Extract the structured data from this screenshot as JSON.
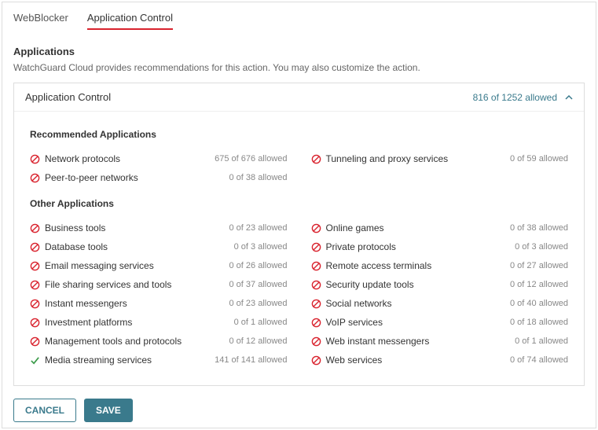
{
  "tabs": {
    "webblocker": "WebBlocker",
    "appcontrol": "Application Control"
  },
  "section": {
    "title": "Applications",
    "description": "WatchGuard Cloud provides recommendations for this action. You may also customize the action."
  },
  "panel": {
    "title": "Application Control",
    "summary": "816 of 1252 allowed"
  },
  "groups": {
    "recommended": {
      "title": "Recommended Applications",
      "left": [
        {
          "name": "Network protocols",
          "count": "675 of 676 allowed",
          "status": "block"
        },
        {
          "name": "Peer-to-peer networks",
          "count": "0 of 38 allowed",
          "status": "block"
        }
      ],
      "right": [
        {
          "name": "Tunneling and proxy services",
          "count": "0 of 59 allowed",
          "status": "block"
        }
      ]
    },
    "other": {
      "title": "Other Applications",
      "left": [
        {
          "name": "Business tools",
          "count": "0 of 23 allowed",
          "status": "block"
        },
        {
          "name": "Database tools",
          "count": "0 of 3 allowed",
          "status": "block"
        },
        {
          "name": "Email messaging services",
          "count": "0 of 26 allowed",
          "status": "block"
        },
        {
          "name": "File sharing services and tools",
          "count": "0 of 37 allowed",
          "status": "block"
        },
        {
          "name": "Instant messengers",
          "count": "0 of 23 allowed",
          "status": "block"
        },
        {
          "name": "Investment platforms",
          "count": "0 of 1 allowed",
          "status": "block"
        },
        {
          "name": "Management tools and protocols",
          "count": "0 of 12 allowed",
          "status": "block"
        },
        {
          "name": "Media streaming services",
          "count": "141 of 141 allowed",
          "status": "allow"
        }
      ],
      "right": [
        {
          "name": "Online games",
          "count": "0 of 38 allowed",
          "status": "block"
        },
        {
          "name": "Private protocols",
          "count": "0 of 3 allowed",
          "status": "block"
        },
        {
          "name": "Remote access terminals",
          "count": "0 of 27 allowed",
          "status": "block"
        },
        {
          "name": "Security update tools",
          "count": "0 of 12 allowed",
          "status": "block"
        },
        {
          "name": "Social networks",
          "count": "0 of 40 allowed",
          "status": "block"
        },
        {
          "name": "VoIP services",
          "count": "0 of 18 allowed",
          "status": "block"
        },
        {
          "name": "Web instant messengers",
          "count": "0 of 1 allowed",
          "status": "block"
        },
        {
          "name": "Web services",
          "count": "0 of 74 allowed",
          "status": "block"
        }
      ]
    }
  },
  "buttons": {
    "cancel": "CANCEL",
    "save": "SAVE"
  }
}
